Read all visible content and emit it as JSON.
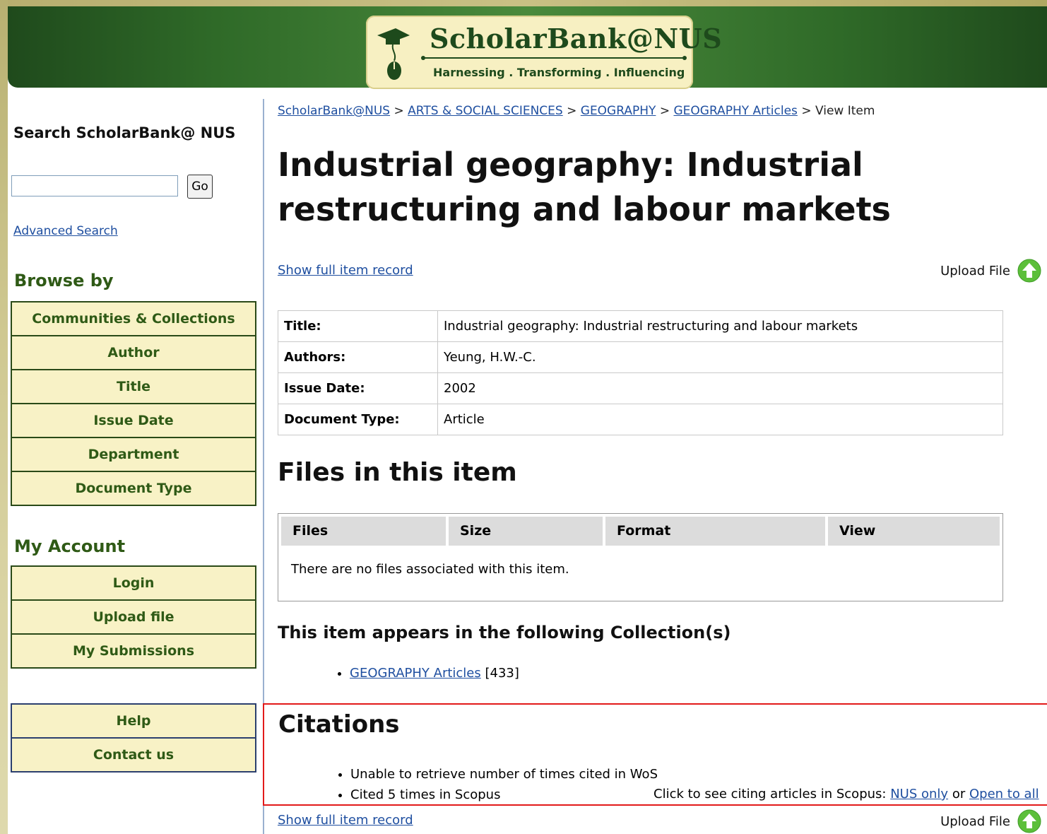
{
  "header": {
    "site_name": "ScholarBank@NUS",
    "tagline": "Harnessing . Transforming . Influencing"
  },
  "sidebar": {
    "search_heading": "Search ScholarBank@ NUS",
    "search_value": "",
    "go_label": "Go",
    "advanced_search": "Advanced Search",
    "browse_heading": "Browse by",
    "browse_items": [
      "Communities & Collections",
      "Author",
      "Title",
      "Issue Date",
      "Department",
      "Document Type"
    ],
    "account_heading": "My Account",
    "account_items": [
      "Login",
      "Upload file",
      "My Submissions"
    ],
    "help_items": [
      "Help",
      "Contact us"
    ]
  },
  "breadcrumb": {
    "items": [
      "ScholarBank@NUS",
      "ARTS & SOCIAL SCIENCES",
      "GEOGRAPHY",
      "GEOGRAPHY Articles"
    ],
    "current": "View Item",
    "separator": ">"
  },
  "item": {
    "title": "Industrial geography: Industrial restructuring and labour markets",
    "show_full_record": "Show full item record",
    "upload_file": "Upload File",
    "metadata": [
      {
        "label": "Title:",
        "value": "Industrial geography: Industrial restructuring and labour markets"
      },
      {
        "label": "Authors:",
        "value": "Yeung, H.W.-C."
      },
      {
        "label": "Issue Date:",
        "value": "2002"
      },
      {
        "label": "Document Type:",
        "value": "Article"
      }
    ]
  },
  "files": {
    "heading": "Files in this item",
    "columns": [
      "Files",
      "Size",
      "Format",
      "View"
    ],
    "empty_message": "There are no files associated with this item."
  },
  "collections": {
    "heading": "This item appears in the following Collection(s)",
    "items": [
      {
        "name": "GEOGRAPHY Articles",
        "count": "[433]"
      }
    ]
  },
  "citations": {
    "heading": "Citations",
    "wos": "Unable to retrieve number of times cited in WoS",
    "scopus": "Cited 5 times in Scopus",
    "scopus_prompt": "Click to see citing articles in Scopus:",
    "nus_only": "NUS only",
    "or": "or",
    "open_to_all": "Open to all"
  },
  "colors": {
    "banner_green": "#2f6a28",
    "menu_bg": "#f8f2c6",
    "menu_text": "#2f5a16",
    "link": "#1f4fa0",
    "highlight_border": "#e21a1a",
    "upload_icon": "#5cbf3a"
  },
  "icons": {
    "logo": "graduation-cap-mouse-icon",
    "upload": "upload-arrow-icon"
  }
}
